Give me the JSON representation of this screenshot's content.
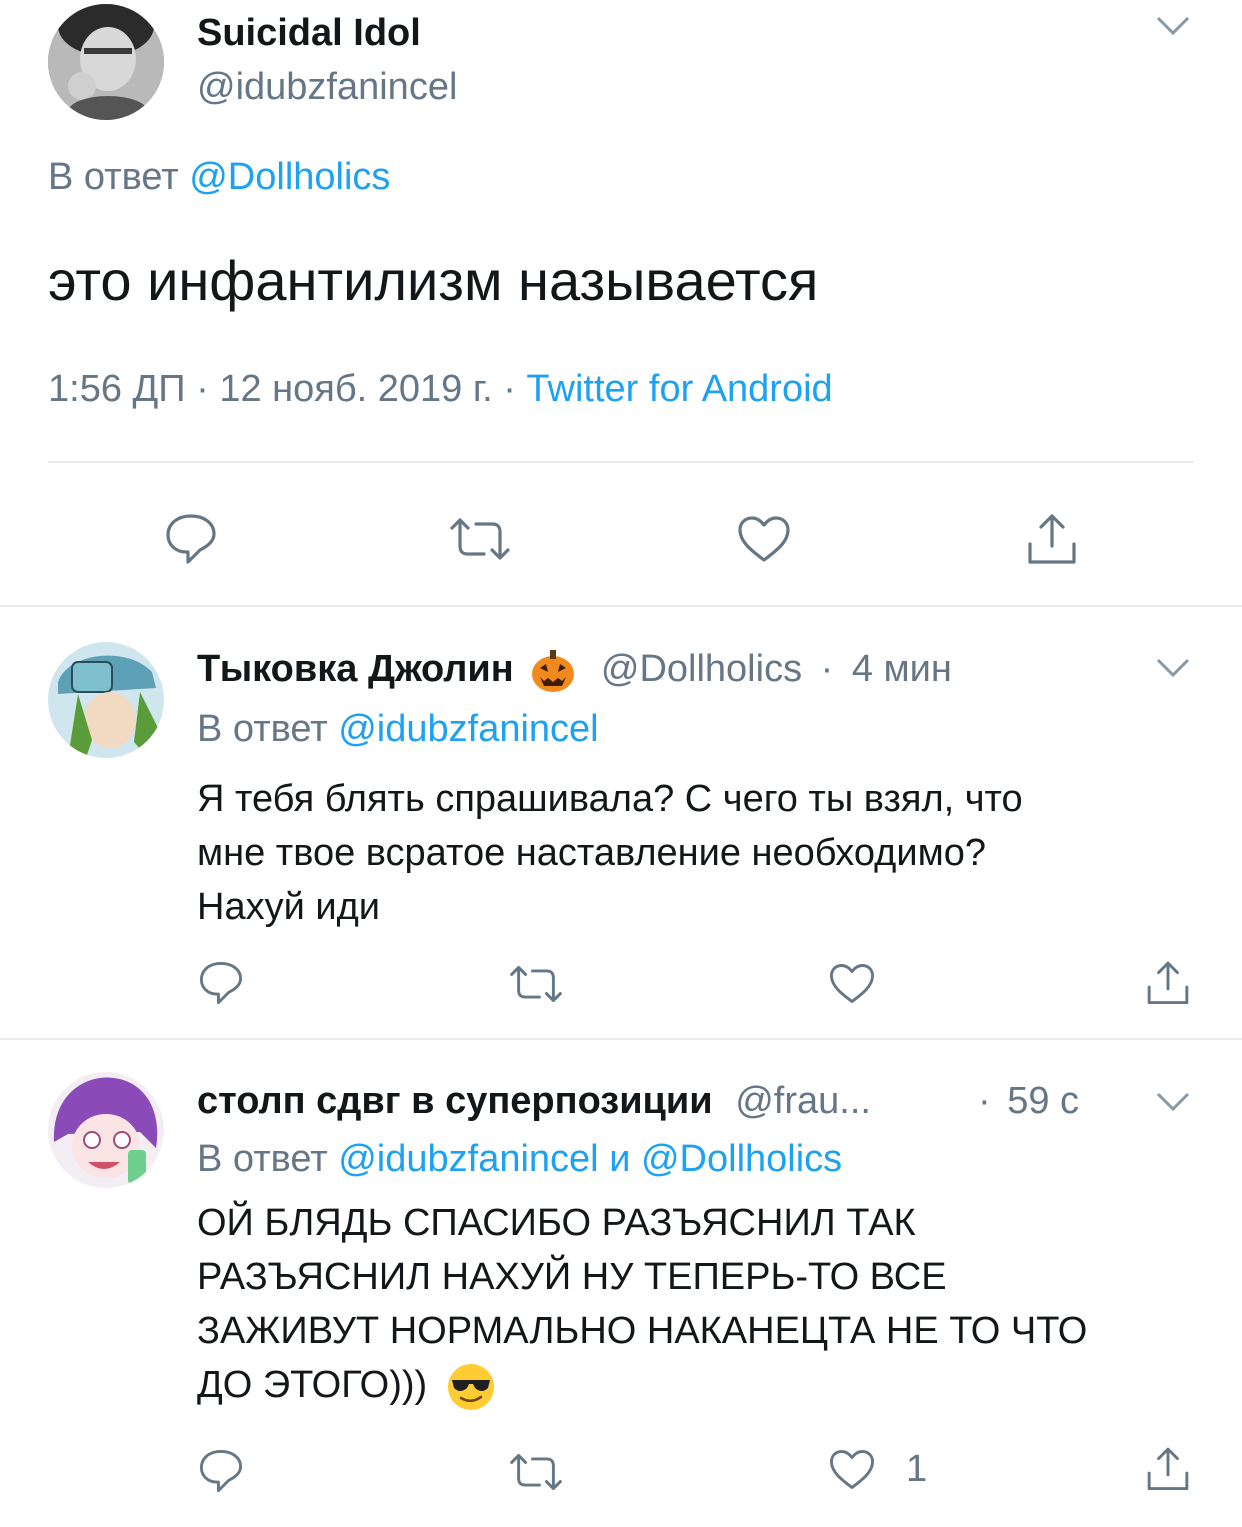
{
  "main_tweet": {
    "display_name": "Suicidal Idol",
    "handle": "@idubzfanincel",
    "reply_prefix": "В ответ",
    "reply_to": "@Dollholics",
    "text": "это инфантилизм называется",
    "time": "1:56 ДП",
    "date": "12 нояб. 2019 г.",
    "separator": "·",
    "source": "Twitter for Android"
  },
  "replies": [
    {
      "display_name": "Тыковка Джолин",
      "emoji": "jack-o-lantern-emoji",
      "handle": "@Dollholics",
      "separator": "·",
      "age": "4 мин",
      "reply_prefix": "В ответ",
      "reply_to": "@idubzfanincel",
      "text_lines": [
        "Я тебя блять спрашивала? С чего ты взял, что",
        "мне твое всратое наставление необходимо?",
        "Нахуй иди"
      ],
      "like_count": ""
    },
    {
      "display_name": "столп сдвг в суперпозиции",
      "handle": "@frau...",
      "separator": "·",
      "age": "59 с",
      "reply_prefix": "В ответ",
      "reply_to_1": "@idubzfanincel",
      "reply_and": "и",
      "reply_to_2": "@Dollholics",
      "text_lines": [
        "ОЙ БЛЯДЬ СПАСИБО РАЗЪЯСНИЛ ТАК",
        "РАЗЪЯСНИЛ НАХУЙ НУ ТЕПЕРЬ-ТО ВСЕ",
        "ЗАЖИВУТ НОРМАЛЬНО НАКАНЕЦТА НЕ ТО ЧТО",
        "ДО ЭТОГО)))"
      ],
      "emoji": "sunglasses-emoji",
      "like_count": "1"
    }
  ],
  "colors": {
    "link": "#1da1f2",
    "muted": "#657786",
    "text": "#14171a",
    "divider": "#e6ecf0"
  },
  "icons": [
    "chevron-down-icon",
    "reply-icon",
    "retweet-icon",
    "like-icon",
    "share-icon"
  ]
}
